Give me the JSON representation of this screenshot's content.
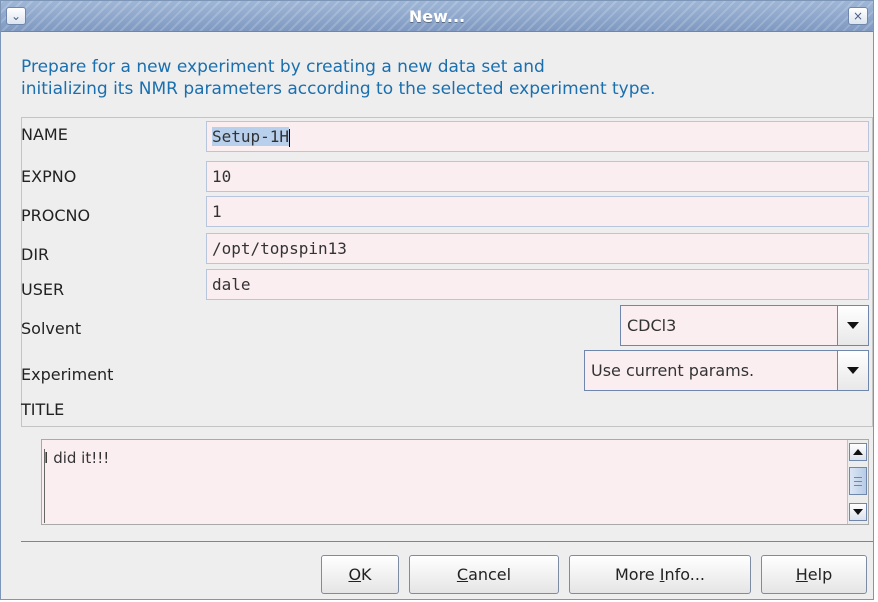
{
  "window": {
    "title": "New...",
    "menu_glyph": "⌄",
    "close_glyph": "×"
  },
  "description": {
    "line1": "Prepare for a new experiment by creating a new data set and",
    "line2": "initializing its NMR parameters according to the selected experiment type."
  },
  "form": {
    "name": {
      "label": "NAME",
      "value_selected": "Setup-1H",
      "value_rest": ""
    },
    "expno": {
      "label": "EXPNO",
      "value": "10"
    },
    "procno": {
      "label": "PROCNO",
      "value": "1"
    },
    "dir": {
      "label": "DIR",
      "value": "/opt/topspin13"
    },
    "user": {
      "label": "USER",
      "value": "dale"
    },
    "solvent": {
      "label": "Solvent",
      "value": "CDCl3"
    },
    "experiment": {
      "label": "Experiment",
      "value": "Use current params."
    },
    "title": {
      "label": "TITLE",
      "value": "I did it!!!"
    }
  },
  "buttons": {
    "ok": {
      "mnemonic": "O",
      "rest": "K"
    },
    "cancel": {
      "mnemonic": "C",
      "rest": "ancel"
    },
    "more_info": {
      "prefix": "More ",
      "mnemonic": "I",
      "rest": "nfo..."
    },
    "help": {
      "mnemonic": "H",
      "rest": "elp"
    }
  },
  "colors": {
    "field_bg": "#fbeef1",
    "description": "#1a6fae",
    "title_bar": "#8aa3c8"
  }
}
